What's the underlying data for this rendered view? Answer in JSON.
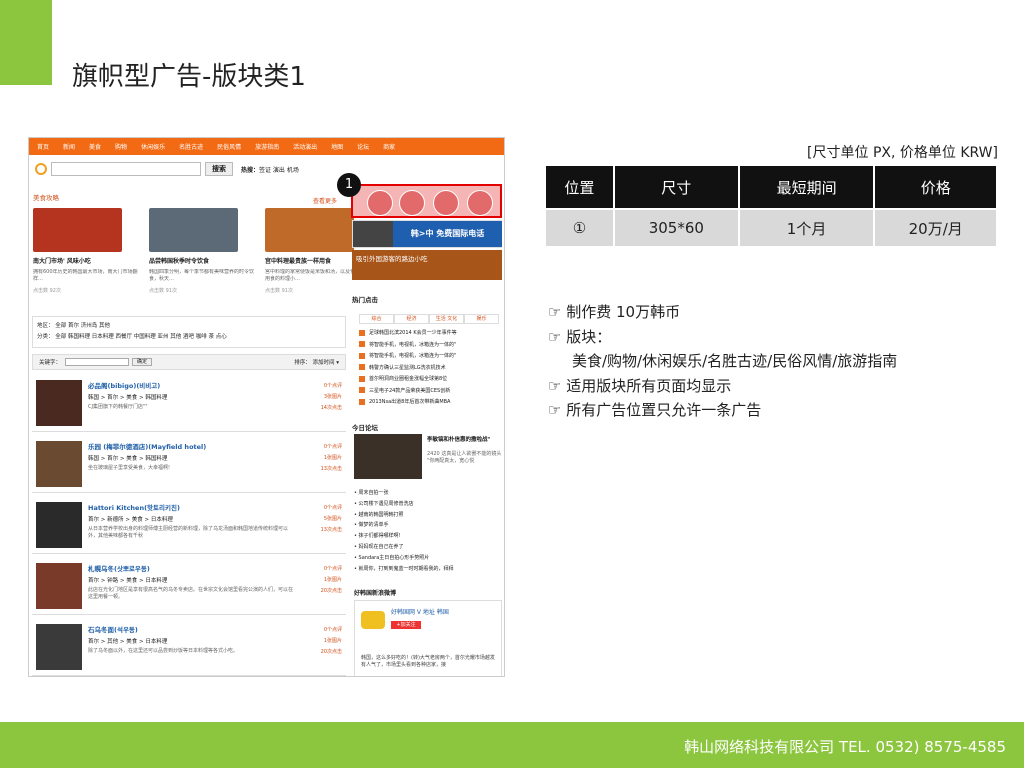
{
  "slide": {
    "title": "旗帜型广告-版块类1",
    "footer": "韩山网络科技有限公司  TEL. 0532) 8575-4585"
  },
  "site": {
    "nav": [
      "首页",
      "新闻",
      "美食",
      "购物",
      "休闲娱乐",
      "名胜古迹",
      "民俗风情",
      "旅游指南",
      "活动演出",
      "地图",
      "论坛",
      "商家"
    ],
    "search_button": "搜索",
    "hot_label": "热搜：",
    "hot_terms": "签证 演出 机场",
    "section_title": "美食攻略",
    "more_label": "查看更多",
    "food_cards": [
      {
        "caption": "南大门市场' 风味小吃",
        "desc": "拥有600年历史的韩国最大市场，南大门市场翻样…",
        "count": "点击数 92次",
        "color": "#b5341f"
      },
      {
        "caption": "品尝韩国秋季时令饮食",
        "desc": "韩国四季分明，每个季节都有美味营养的时令饮食，秋天…",
        "count": "点击数 91次",
        "color": "#5c6a78"
      },
      {
        "caption": "宫中料理最贵族一样用食",
        "desc": "宫中料理的家常便饭是米饭和汤，以及包括宫中用食的料理小…",
        "count": "点击数 91次",
        "color": "#c06a2a"
      }
    ],
    "filter_area": "地区：  全部  首尔  济州岛  其他",
    "filter_type": "分类：  全部  韩国料理  日本料理  西餐厅  中国料理  亚州  其他  酒吧  咖啡  茶  点心",
    "keyword_label": "关键字：",
    "confirm_label": "确定",
    "sort_label": "排序：  添加时间 ▾",
    "listings": [
      {
        "name": "必品阁(bibigo)(비비고)",
        "crumb": "韩国 > 首尔 > 美食 > 韩国料理",
        "desc": "CJ集团旗下的韩餐厅门店\"\"",
        "stats": [
          "0个点评",
          "3张图片",
          "14次点击"
        ],
        "color": "#4a2a20"
      },
      {
        "name": "乐园 (梅菲尔德酒店)(Mayfield hotel)",
        "crumb": "韩国 > 首尔 > 美食 > 韩国料理",
        "desc": "坐在玻璃屋子里享受美食，大幸福啊!",
        "stats": [
          "0个点评",
          "1张图片",
          "13次点击"
        ],
        "color": "#6a4a30"
      },
      {
        "name": "Hattori Kitchen(핫토리키친)",
        "crumb": "首尔 > 新德所 > 美食 > 日本料理",
        "desc": "从日本营养学校出身的料理师傅主厨经营的新料理，除了乌龙汤面和韩国地道传统料理可以外，其他美味都各有千秋",
        "stats": [
          "0个点评",
          "5张图片",
          "13次点击"
        ],
        "color": "#2a2a2a"
      },
      {
        "name": "札幌乌冬(삿뽀로우동)",
        "crumb": "首尔 > 钟路 > 美食 > 日本料理",
        "desc": "此店在光化门地区是享有很高名气的乌冬专卖店。在世宗文化会馆里看完公演的人们，可以在这里用餐一顿。",
        "stats": [
          "0个点评",
          "1张图片",
          "20次点击"
        ],
        "color": "#7a3a2a"
      },
      {
        "name": "石乌冬面(석우동)",
        "crumb": "首尔 > 其他 > 美食 > 日本料理",
        "desc": "除了乌冬面以外，在这里还可以品尝到炒饭等日本料理等各式小吃。",
        "stats": [
          "0个点评",
          "1张图片",
          "20次点击"
        ],
        "color": "#3a3a3a"
      }
    ],
    "banner_korea_call": "韩>中 免费国际电话",
    "banner_snack": "吸引外国游客的路边小吃",
    "hot_click_title": "热门点击",
    "hot_tabs": [
      "综合",
      "经济",
      "生活 文化",
      "娱乐"
    ],
    "hot_items": [
      "足球韩国北滨2014 K会员一少年事件等",
      "将智能手机，电视机，冰箱连为一体的\"",
      "将智能手机，电视机，冰箱连为一体的\"",
      "韩警方确认三星监测LG洗衣机技术",
      "首尔明洞商业圈租金涨幅全球第8位",
      "三星电子24款产品荣获美国CES创新",
      "2013Nsa出道8年后首次带新曲MBA"
    ],
    "today_title": "今日论坛",
    "today_headline": "李敏镐和朴信惠的撒啦战\"",
    "today_desc": "2420 这真是让人欲罢不能的镜头 \"你两配真太，宽心悦",
    "bullets": [
      "周末自拍一张",
      "公司楼下遇见周修普洗店",
      "越南的韩国明韩打照",
      "做梦的清单手",
      "抹子们都得哪样啊!",
      "妈妈现在自己在养了",
      "Sandara主日自拍心形手势照片",
      "就周你，打到到鬼蓝一时时期看我的，拜拜"
    ],
    "weibo_title": "好韩国新浪微博",
    "weibo_name": "好韩国网 V 地址 韩国",
    "weibo_follow": "+加关注",
    "weibo_desc": "韩国，这么多好吃的！(转)大气老房两个，首尔光耀市场越发有人气了，市场里头看到各种店家，接"
  },
  "ad_marker": "1",
  "table": {
    "unit_note": "[尺寸单位 PX, 价格单位 KRW]",
    "headers": [
      "位置",
      "尺寸",
      "最短期间",
      "价格"
    ],
    "rows": [
      [
        "①",
        "305*60",
        "1个月",
        "20万/月"
      ]
    ]
  },
  "notes": {
    "n1": "☞ 制作费 10万韩币",
    "n2": "☞ 版块：",
    "n3": "美食/购物/休闲娱乐/名胜古迹/民俗风情/旅游指南",
    "n4": "☞ 适用版块所有页面均显示",
    "n5": "☞ 所有广告位置只允许一条广告"
  }
}
